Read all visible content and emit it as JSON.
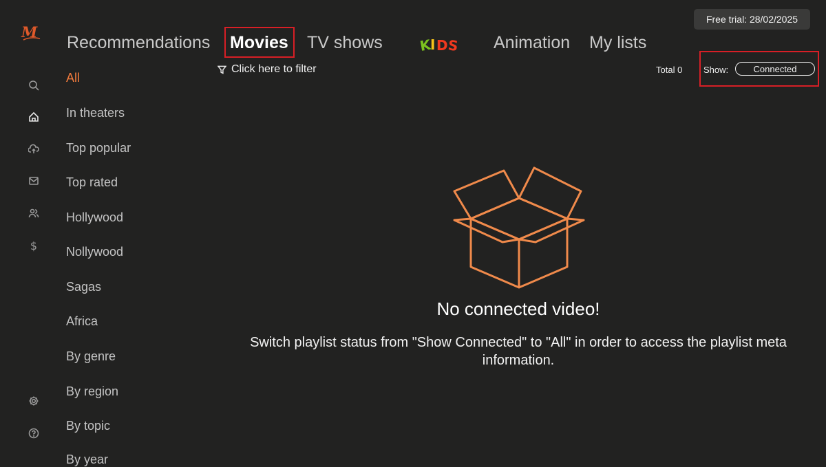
{
  "brand": {
    "logo_letter": "M",
    "accent_color": "#f07a3c",
    "highlight_color": "#d81f26"
  },
  "trial": {
    "label": "Free trial: 28/02/2025"
  },
  "tabs": [
    {
      "label": "Recommendations"
    },
    {
      "label": "Movies",
      "active": true
    },
    {
      "label": "TV shows"
    },
    {
      "label": "KIDS",
      "type": "logo"
    },
    {
      "label": "Animation"
    },
    {
      "label": "My lists"
    }
  ],
  "filter": {
    "label": "Click here to filter",
    "icon": "filter-icon"
  },
  "total": {
    "label": "Total 0"
  },
  "show": {
    "label": "Show:",
    "value": "Connected"
  },
  "categories": [
    {
      "label": "All",
      "active": true
    },
    {
      "label": "In theaters"
    },
    {
      "label": "Top popular"
    },
    {
      "label": "Top rated"
    },
    {
      "label": "Hollywood"
    },
    {
      "label": "Nollywood"
    },
    {
      "label": "Sagas"
    },
    {
      "label": "Africa"
    },
    {
      "label": "By genre"
    },
    {
      "label": "By region"
    },
    {
      "label": "By topic"
    },
    {
      "label": "By year"
    }
  ],
  "rail_icons": [
    "search-icon",
    "home-icon",
    "cloud-upload-icon",
    "mail-icon",
    "users-icon",
    "dollar-icon",
    "settings-icon",
    "help-icon"
  ],
  "empty_state": {
    "icon": "open-box-icon",
    "title": "No connected video!",
    "description": "Switch playlist status from \"Show Connected\" to \"All\" in order to access the playlist meta information."
  }
}
